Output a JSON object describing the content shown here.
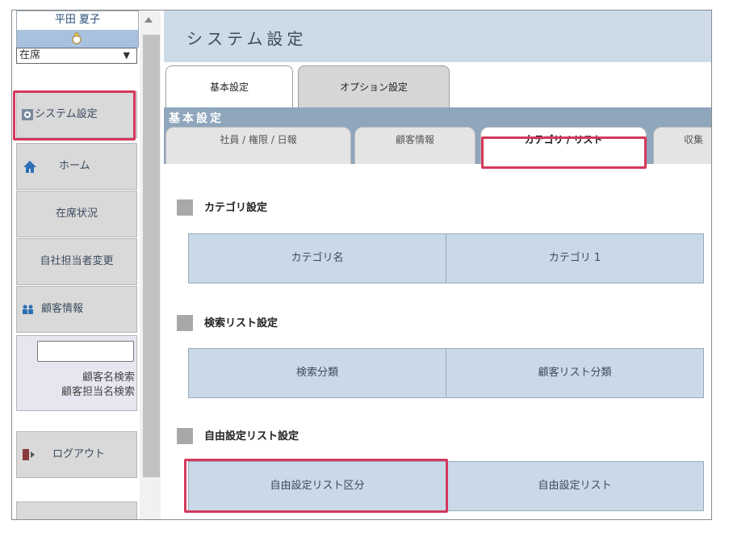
{
  "sidebar": {
    "user_name": "平田 夏子",
    "status_value": "在席",
    "status_arrow": "▼",
    "items": [
      {
        "label": "システム設定",
        "icon": "gear-icon"
      },
      {
        "label": "ホーム",
        "icon": "home-icon"
      },
      {
        "label": "在席状況"
      },
      {
        "label": "自社担当者変更"
      },
      {
        "label": "顧客情報",
        "icon": "users-icon"
      }
    ],
    "search": {
      "customer_name_search": "顧客名検索",
      "customer_staff_search": "顧客担当名検索"
    },
    "logout_label": "ログアウト"
  },
  "main": {
    "page_title": "システム設定",
    "top_tabs": [
      {
        "label": "基本設定",
        "active": true
      },
      {
        "label": "オプション設定",
        "active": false
      }
    ],
    "section_title": "基本設定",
    "sub_tabs": [
      {
        "label": "社員 / 権限 / 日報"
      },
      {
        "label": "顧客情報"
      },
      {
        "label": "カテゴリ / リスト",
        "active": true
      },
      {
        "label": "収集"
      }
    ],
    "groups": [
      {
        "title": "カテゴリ設定",
        "cells": [
          "カテゴリ名",
          "カテゴリ 1"
        ]
      },
      {
        "title": "検索リスト設定",
        "cells": [
          "検索分類",
          "顧客リスト分類"
        ]
      },
      {
        "title": "自由設定リスト設定",
        "cells": [
          "自由設定リスト区分",
          "自由設定リスト"
        ]
      }
    ]
  },
  "colors": {
    "highlight": "#d4385c",
    "header_bg": "#cddbe9",
    "section_bar": "#8fa6bd",
    "cell_bg": "#cad9e7",
    "nav_bg": "#d9d9d9"
  }
}
